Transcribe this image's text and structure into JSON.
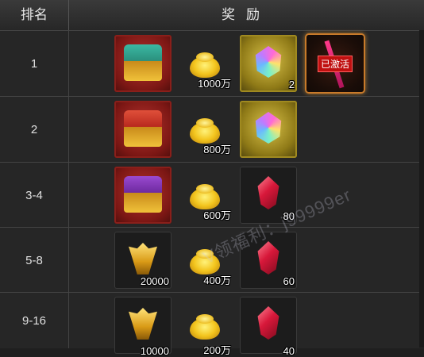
{
  "header": {
    "rank_label": "排名",
    "reward_label": "奖励"
  },
  "rows": [
    {
      "rank": "1",
      "chest_qty": "",
      "ingot_qty": "1000万",
      "item3_qty": "2",
      "activated_label": "已激活"
    },
    {
      "rank": "2",
      "chest_qty": "",
      "ingot_qty": "800万",
      "item3_qty": ""
    },
    {
      "rank": "3-4",
      "chest_qty": "",
      "ingot_qty": "600万",
      "item3_qty": "80"
    },
    {
      "rank": "5-8",
      "helm_qty": "20000",
      "ingot_qty": "400万",
      "item3_qty": "60"
    },
    {
      "rank": "9-16",
      "helm_qty": "10000",
      "ingot_qty": "200万",
      "item3_qty": "40"
    }
  ],
  "watermark": "V领福利：j99999er"
}
